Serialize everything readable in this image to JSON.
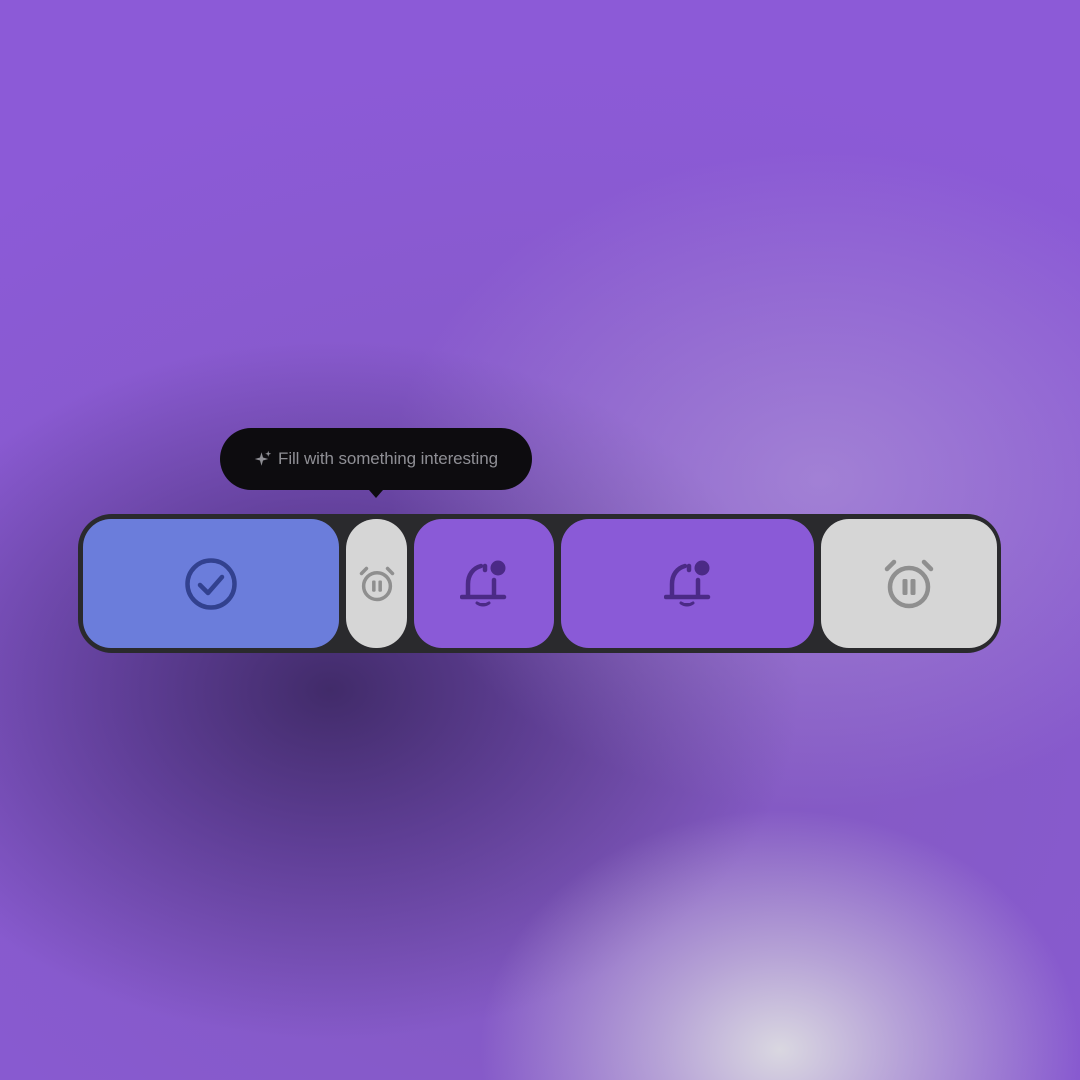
{
  "tooltip": {
    "text": "Fill with something interesting",
    "icon": "sparkle-icon"
  },
  "segments": [
    {
      "icon": "check-circle-icon",
      "color": "#6b7ddb"
    },
    {
      "icon": "alarm-pause-icon",
      "color": "#d6d6d6"
    },
    {
      "icon": "bell-notification-icon",
      "color": "#8a5ad7"
    },
    {
      "icon": "bell-notification-icon",
      "color": "#8a5ad7"
    },
    {
      "icon": "alarm-pause-icon",
      "color": "#d6d6d6"
    }
  ],
  "colors": {
    "bar_background": "#2a2a2d",
    "tooltip_background": "#0d0c0f",
    "tooltip_text": "#8f8f95"
  }
}
